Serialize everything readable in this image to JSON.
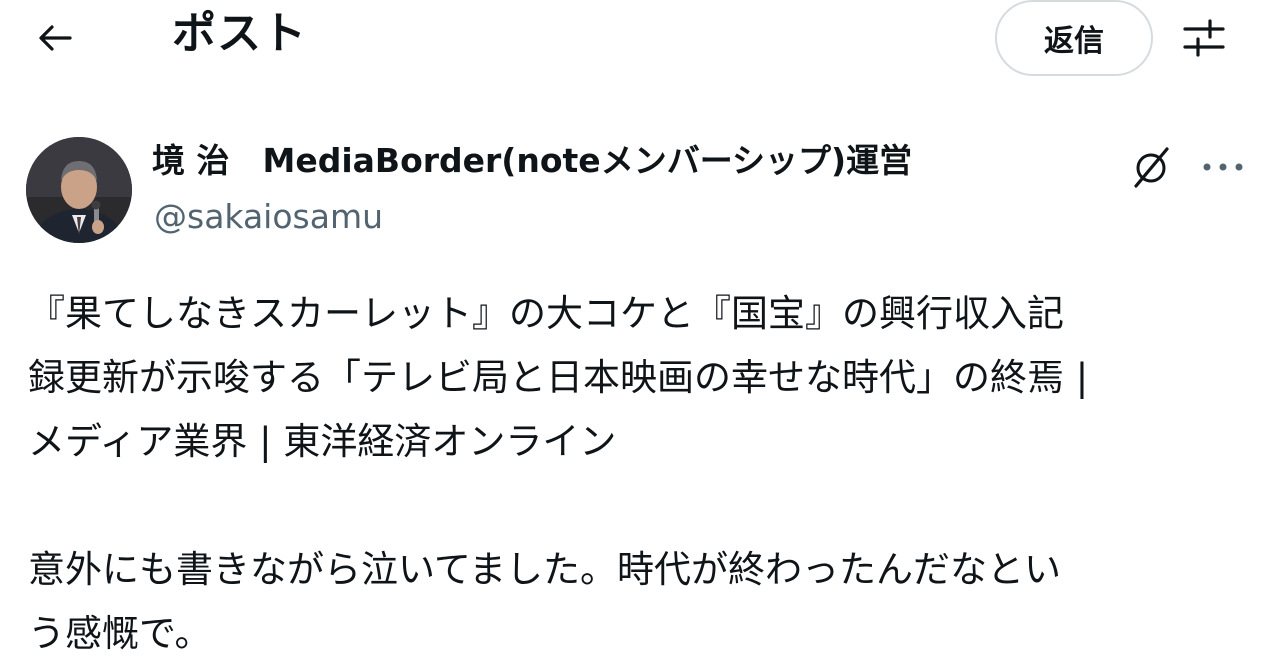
{
  "header": {
    "title": "ポスト",
    "reply_label": "返信",
    "back_icon": "arrow-left-icon",
    "filter_icon": "sliders-icon"
  },
  "author": {
    "name": "境 治　MediaBorder(noteメンバーシップ)運営",
    "handle": "@sakaiosamu"
  },
  "post": {
    "link_line_1": "『果てしなきスカーレット』の大コケと『国宝』の興行収入記",
    "link_line_2": "録更新が示唆する「テレビ局と日本映画の幸せな時代」の終焉 |",
    "link_line_3": "メディア業界 | 東洋経済オンライン",
    "comment_line_1": "意外にも書きながら泣いてました。時代が終わったんだなとい",
    "comment_line_2": "う感慨で。"
  },
  "colors": {
    "text": "#0f1419",
    "secondary": "#536471",
    "border": "#d6dbe0"
  }
}
